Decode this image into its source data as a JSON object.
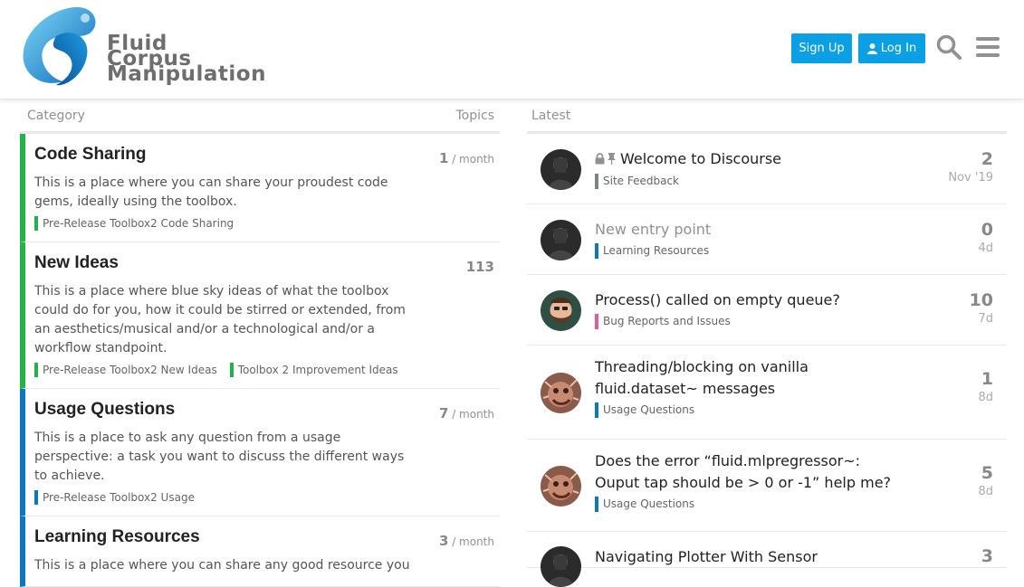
{
  "brand": {
    "line1": "Fluid",
    "line2": "Corpus",
    "line3": "Manipulation",
    "logo_colors": [
      "#1e8fd0",
      "#59c7f2",
      "#0a5fa8"
    ]
  },
  "header": {
    "signup_label": "Sign Up",
    "login_label": "Log In",
    "accent": "#0aa0e3"
  },
  "categories_header": {
    "category": "Category",
    "topics": "Topics"
  },
  "latest_header": {
    "latest": "Latest"
  },
  "categories": [
    {
      "title": "Code Sharing",
      "description": "This is a place where you can share your proudest code gems, ideally using the toolbox.",
      "count": "1",
      "per": " / month",
      "color": "#25b24a",
      "subcategories": [
        "Pre-Release Toolbox2 Code Sharing"
      ]
    },
    {
      "title": "New Ideas",
      "description": "This is a place where blue sky ideas of what the toolbox could do for you, how it could be stirred or extended, from an aesthetics/musical and/or a technological and/or a workflow standpoint.",
      "count": "113",
      "per": "",
      "color": "#25b24a",
      "subcategories": [
        "Pre-Release Toolbox2 New Ideas",
        "Toolbox 2 Improvement Ideas"
      ]
    },
    {
      "title": "Usage Questions",
      "description": "This is a place to ask any question from a usage perspective: a task you want to discuss the different ways to achieve.",
      "count": "7",
      "per": " / month",
      "color": "#0e76bd",
      "subcategories": [
        "Pre-Release Toolbox2 Usage"
      ]
    },
    {
      "title": "Learning Resources",
      "description": "This is a place where you can share any good resource you",
      "count": "3",
      "per": " / month",
      "color": "#0e76bd",
      "subcategories": []
    }
  ],
  "topics": [
    {
      "title": "Welcome to Discourse",
      "category": "Site Feedback",
      "cat_color": "#808281",
      "posts": "2",
      "age": "Nov '19",
      "locked": true,
      "pinned": true,
      "muted": false,
      "avatar": "dark"
    },
    {
      "title": "New entry point",
      "category": "Learning Resources",
      "cat_color": "#0e76bd",
      "posts": "0",
      "age": "4d",
      "locked": false,
      "pinned": false,
      "muted": true,
      "avatar": "dark"
    },
    {
      "title": "Process() called on empty queue?",
      "category": "Bug Reports and Issues",
      "cat_color": "#e45c9b",
      "posts": "10",
      "age": "7d",
      "locked": false,
      "pinned": false,
      "muted": false,
      "avatar": "beard"
    },
    {
      "title": "Threading/blocking on vanilla fluid.dataset~ messages",
      "category": "Usage Questions",
      "cat_color": "#0e76bd",
      "posts": "1",
      "age": "8d",
      "locked": false,
      "pinned": false,
      "muted": false,
      "avatar": "creature"
    },
    {
      "title": "Does the error “fluid.mlpregressor~: Ouput tap should be > 0 or -1” help me?",
      "category": "Usage Questions",
      "cat_color": "#0e76bd",
      "posts": "5",
      "age": "8d",
      "locked": false,
      "pinned": false,
      "muted": false,
      "avatar": "creature"
    },
    {
      "title": "Navigating Plotter With Sensor",
      "category": "",
      "cat_color": "#0e76bd",
      "posts": "3",
      "age": "",
      "locked": false,
      "pinned": false,
      "muted": false,
      "avatar": "dark"
    }
  ]
}
